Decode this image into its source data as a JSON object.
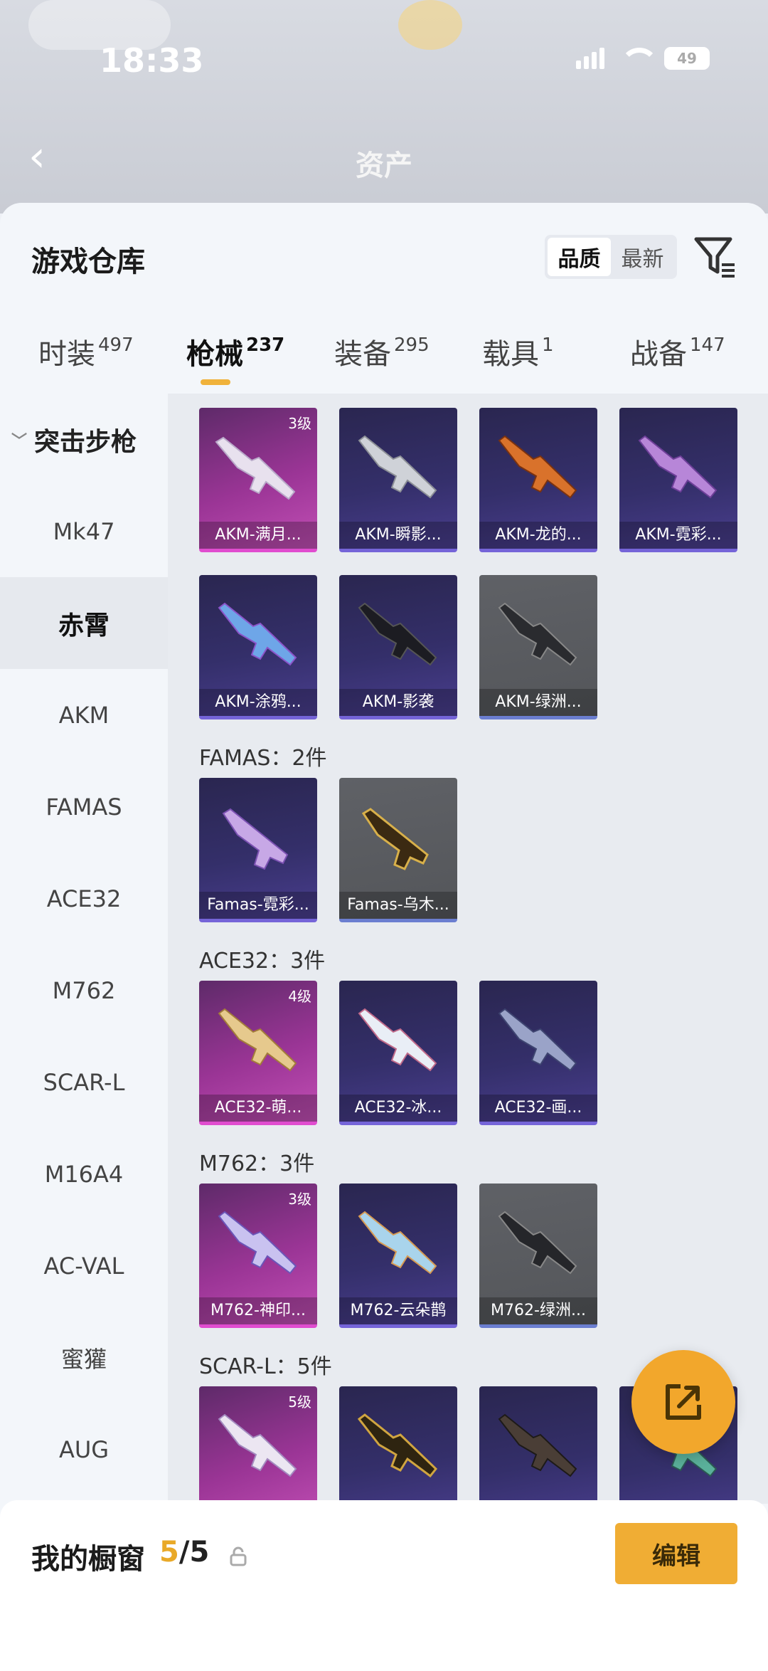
{
  "status_bar": {
    "time": "18:33",
    "battery": "49"
  },
  "nav": {
    "title": "资产",
    "back_icon": "chevron-left-icon"
  },
  "sheet": {
    "title": "游戏仓库",
    "sort": {
      "options": [
        "品质",
        "最新"
      ],
      "selected": "品质"
    },
    "filter_icon": "filter-icon"
  },
  "tabs": [
    {
      "label": "时装",
      "count": "497"
    },
    {
      "label": "枪械",
      "count": "237",
      "active": true
    },
    {
      "label": "装备",
      "count": "295"
    },
    {
      "label": "载具",
      "count": "1"
    },
    {
      "label": "战备",
      "count": "147"
    }
  ],
  "sidebar": {
    "group": "突击步枪",
    "items": [
      "Mk47",
      "赤霄",
      "AKM",
      "FAMAS",
      "ACE32",
      "M762",
      "SCAR-L",
      "M16A4",
      "AC-VAL",
      "蜜獾",
      "AUG"
    ],
    "active": "赤霄"
  },
  "sections": [
    {
      "title": "",
      "cards": [
        {
          "name": "AKM-满月...",
          "grade": "3级",
          "rarity": "purple"
        },
        {
          "name": "AKM-瞬影...",
          "rarity": "blue"
        },
        {
          "name": "AKM-龙的...",
          "rarity": "blue"
        },
        {
          "name": "AKM-霓彩...",
          "rarity": "blue"
        },
        {
          "name": "AKM-涂鸦...",
          "rarity": "blue"
        },
        {
          "name": "AKM-影袭",
          "rarity": "blue"
        },
        {
          "name": "AKM-绿洲...",
          "rarity": "gray"
        }
      ]
    },
    {
      "title": "FAMAS：2件",
      "cards": [
        {
          "name": "Famas-霓彩...",
          "rarity": "blue"
        },
        {
          "name": "Famas-乌木...",
          "rarity": "gray"
        }
      ]
    },
    {
      "title": "ACE32：3件",
      "cards": [
        {
          "name": "ACE32-萌...",
          "grade": "4级",
          "rarity": "purple"
        },
        {
          "name": "ACE32-冰...",
          "rarity": "blue"
        },
        {
          "name": "ACE32-画...",
          "rarity": "blue"
        }
      ]
    },
    {
      "title": "M762：3件",
      "cards": [
        {
          "name": "M762-神印...",
          "grade": "3级",
          "rarity": "purple"
        },
        {
          "name": "M762-云朵鹊",
          "rarity": "blue"
        },
        {
          "name": "M762-绿洲...",
          "rarity": "gray"
        }
      ]
    },
    {
      "title": "SCAR-L：5件",
      "cards": [
        {
          "name": "",
          "grade": "5级",
          "rarity": "purple"
        },
        {
          "name": "",
          "rarity": "blue"
        },
        {
          "name": "",
          "rarity": "blue"
        },
        {
          "name": "",
          "rarity": "blue"
        }
      ]
    }
  ],
  "fab": {
    "icon": "share-icon"
  },
  "bottom_bar": {
    "label": "我的橱窗",
    "count_current": "5",
    "count_total": "/5",
    "lock_icon": "lock-icon",
    "edit_label": "编辑"
  },
  "colors": {
    "accent": "#f0ad34",
    "purple_rarity": "#e04ccf",
    "blue_rarity": "#7564d8"
  }
}
